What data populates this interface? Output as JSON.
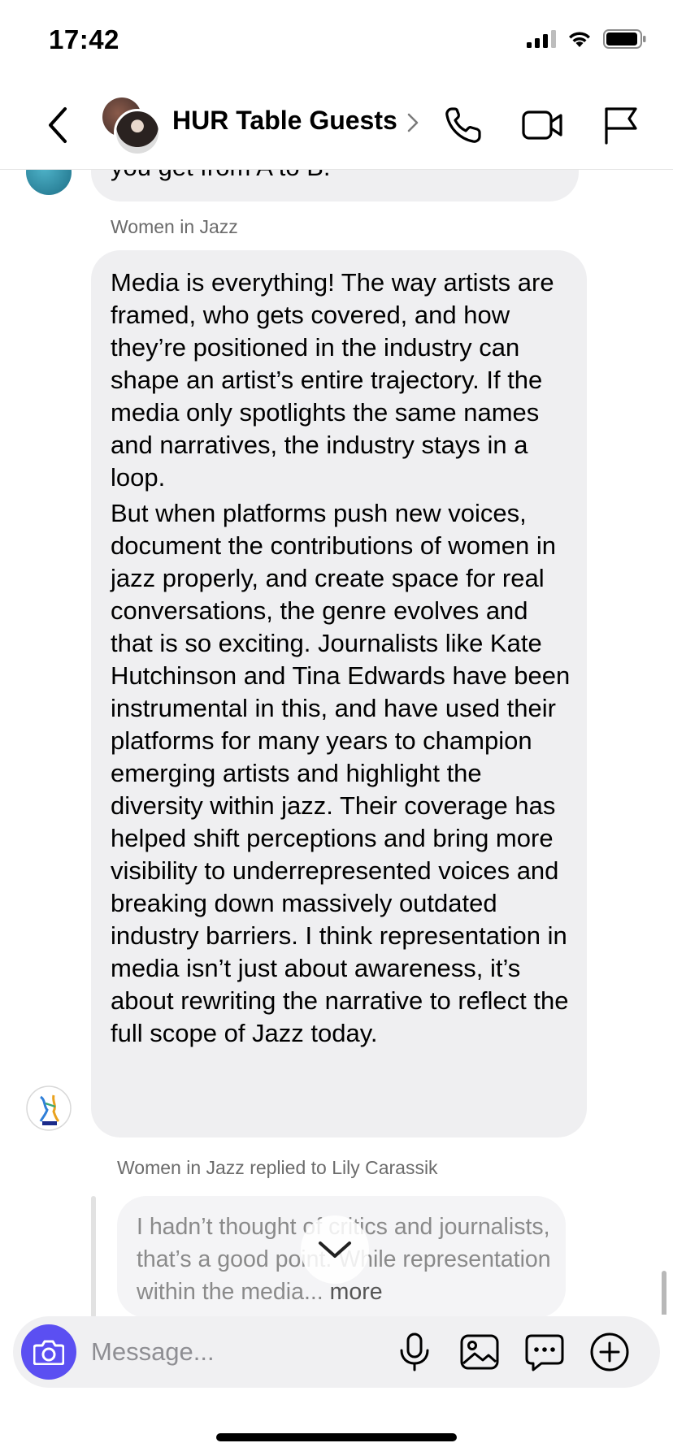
{
  "status_bar": {
    "time": "17:42"
  },
  "header": {
    "title": "HUR Table Guests"
  },
  "messages": {
    "previous_fragment": "you get from A to B.",
    "main": {
      "sender": "Women in Jazz",
      "paragraph1": "Media is everything! The way artists are framed, who gets covered, and how they’re positioned in the industry can shape an artist’s entire trajectory. If the media only spotlights the same names and narratives, the industry stays in a loop.",
      "paragraph2": "But when platforms push new voices, document the contributions of women in jazz properly, and create space for real conversations, the genre evolves and that is so exciting. Journalists like Kate Hutchinson and Tina Edwards have been instrumental in this, and have used their platforms for many years to champion emerging artists and highlight the diversity within jazz. Their coverage has helped shift perceptions and bring more visibility to underrepresented voices and breaking down massively outdated industry barriers. I think representation in media isn’t just about awareness, it’s about rewriting the narrative to reflect the full scope of Jazz today."
    },
    "reply": {
      "context": "Women in Jazz replied to Lily Carassik",
      "quoted_text": "I hadn’t thought of critics and journalists, that’s a good point. While representation within the media...",
      "more_label": "more"
    }
  },
  "composer": {
    "placeholder": "Message..."
  }
}
